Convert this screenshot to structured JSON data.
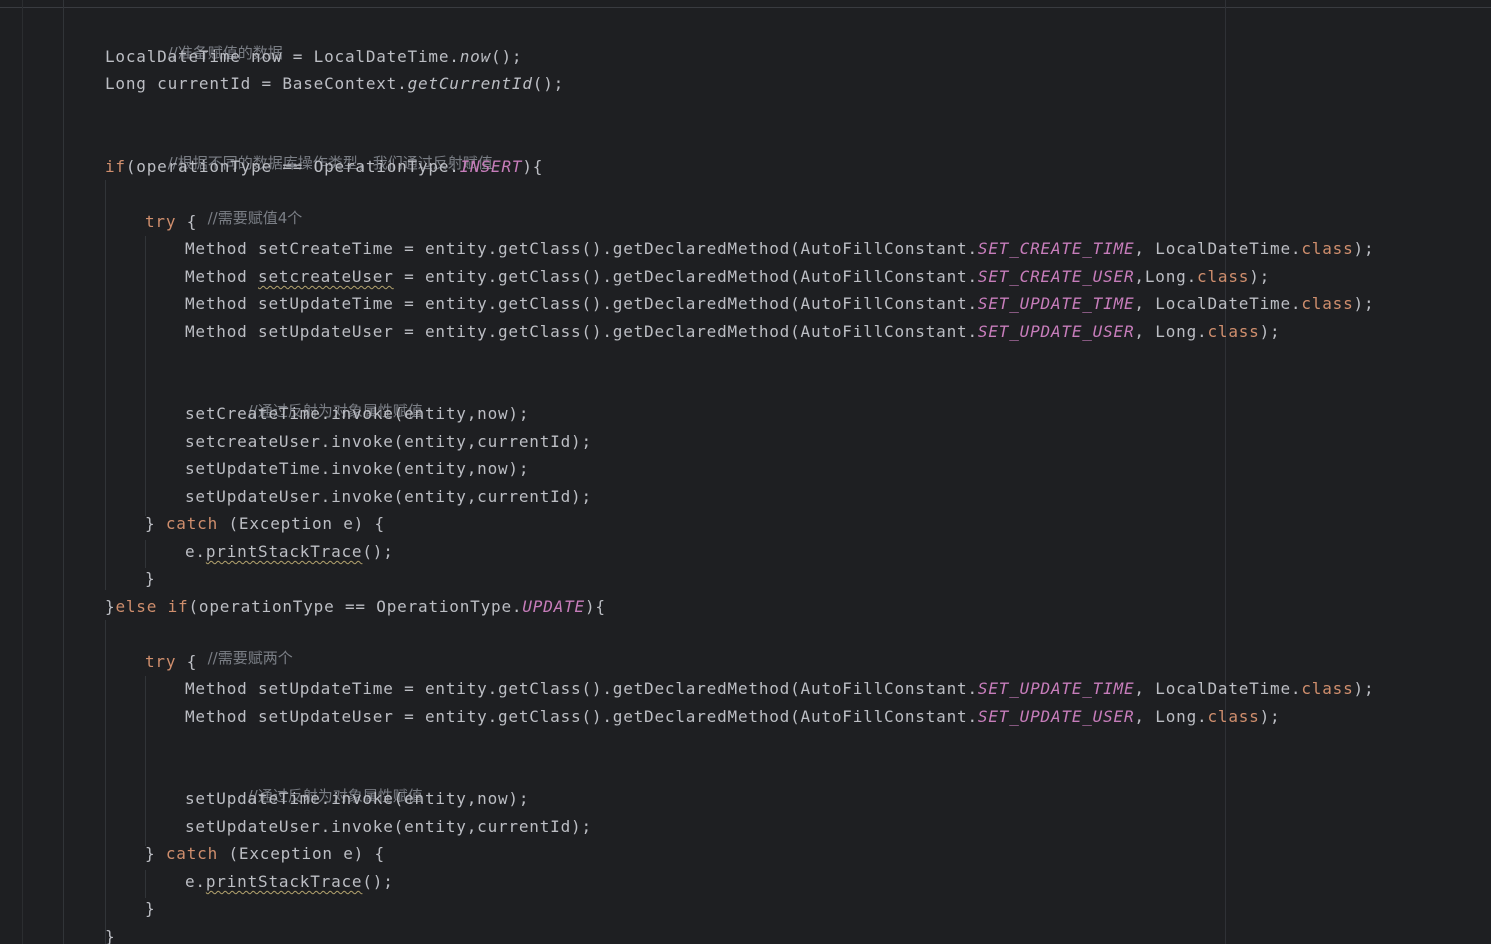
{
  "editor": {
    "comments": {
      "prepare": "//准备赋值的数据",
      "by_type": "//根据不同的数据库操作类型，我们通过反射赋值",
      "need_four": "//需要赋值4个",
      "reflect_assign_1": "//通过反射为对象属性赋值",
      "need_two": "//需要赋两个",
      "reflect_assign_2": "//通过反射为对象属性赋值"
    },
    "tokens": {
      "lt_decl_head": "LocalDateTime now = LocalDateTime.",
      "now_fn": "now",
      "parens_semi": "();",
      "long_decl_head": "Long currentId = BaseContext.",
      "get_current_id": "getCurrentId",
      "if_kw": "if",
      "else_kw": "else",
      "cond_head": "(operationType == OperationType.",
      "insert_const": "INSERT",
      "update_const": "UPDATE",
      "close_brace_open": "){",
      "close_brace_else": "}",
      "try_kw": "try",
      "open_brace": " {",
      "method_kw": "Method ",
      "set_create_time": "setCreateTime",
      "set_create_user": "setcreateUser",
      "set_update_time": "setUpdateTime",
      "set_update_user": "setUpdateUser",
      "get_declared": " = entity.getClass().getDeclaredMethod(AutoFillConstant.",
      "set_create_time_const": "SET_CREATE_TIME",
      "set_create_user_const": "SET_CREATE_USER",
      "set_update_time_const": "SET_UPDATE_TIME",
      "set_update_user_const": "SET_UPDATE_USER",
      "ldt_class_head": ", LocalDateTime.",
      "long_class_head_nospace": ",Long.",
      "long_class_head": ", Long.",
      "class_kw": "class",
      "close_paren_semi": ");",
      "invoke_now": ".invoke(entity,now);",
      "invoke_current": ".invoke(entity,currentId);",
      "catch_open": "} ",
      "catch_kw": "catch",
      "catch_tail": " (Exception e) {",
      "e_dot": "e.",
      "print_stack": "printStackTrace",
      "close": "}"
    }
  }
}
